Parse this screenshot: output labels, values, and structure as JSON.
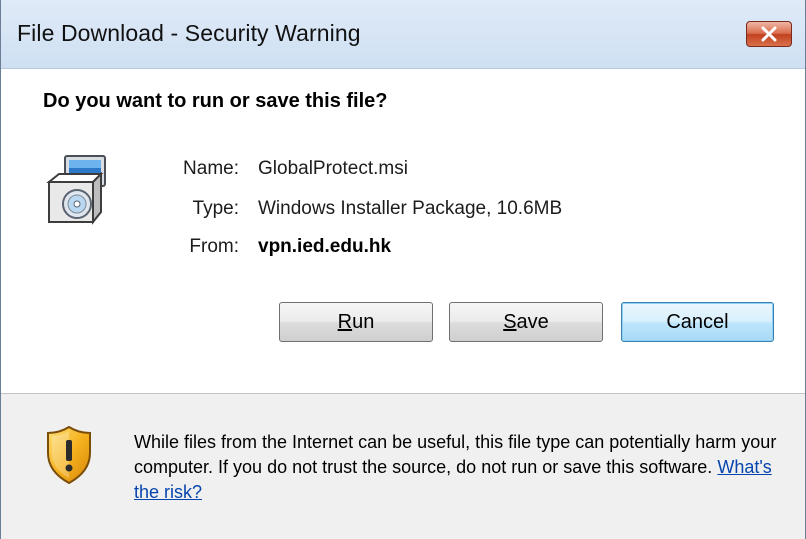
{
  "window": {
    "title": "File Download - Security Warning",
    "close_icon": "close-icon"
  },
  "dialog": {
    "heading": "Do you want to run or save this file?",
    "file_icon": "installer-package-icon",
    "fields": {
      "name_label": "Name:",
      "name_value": "GlobalProtect.msi",
      "type_label": "Type:",
      "type_value": "Windows Installer Package, 10.6MB",
      "from_label": "From:",
      "from_value": "vpn.ied.edu.hk"
    },
    "buttons": {
      "run": {
        "accel": "R",
        "rest": "un"
      },
      "save": {
        "accel": "S",
        "rest": "ave"
      },
      "cancel": "Cancel"
    }
  },
  "footer": {
    "shield_icon": "security-shield-icon",
    "warning_text": "While files from the Internet can be useful, this file type can potentially harm your computer. If you do not trust the source, do not run or save this software.",
    "risk_link": "What's the risk?"
  },
  "colors": {
    "titlebar": "#cfe0f3",
    "close_button": "#c2401f",
    "default_button": "#3c7fb1",
    "link": "#0645ad"
  }
}
